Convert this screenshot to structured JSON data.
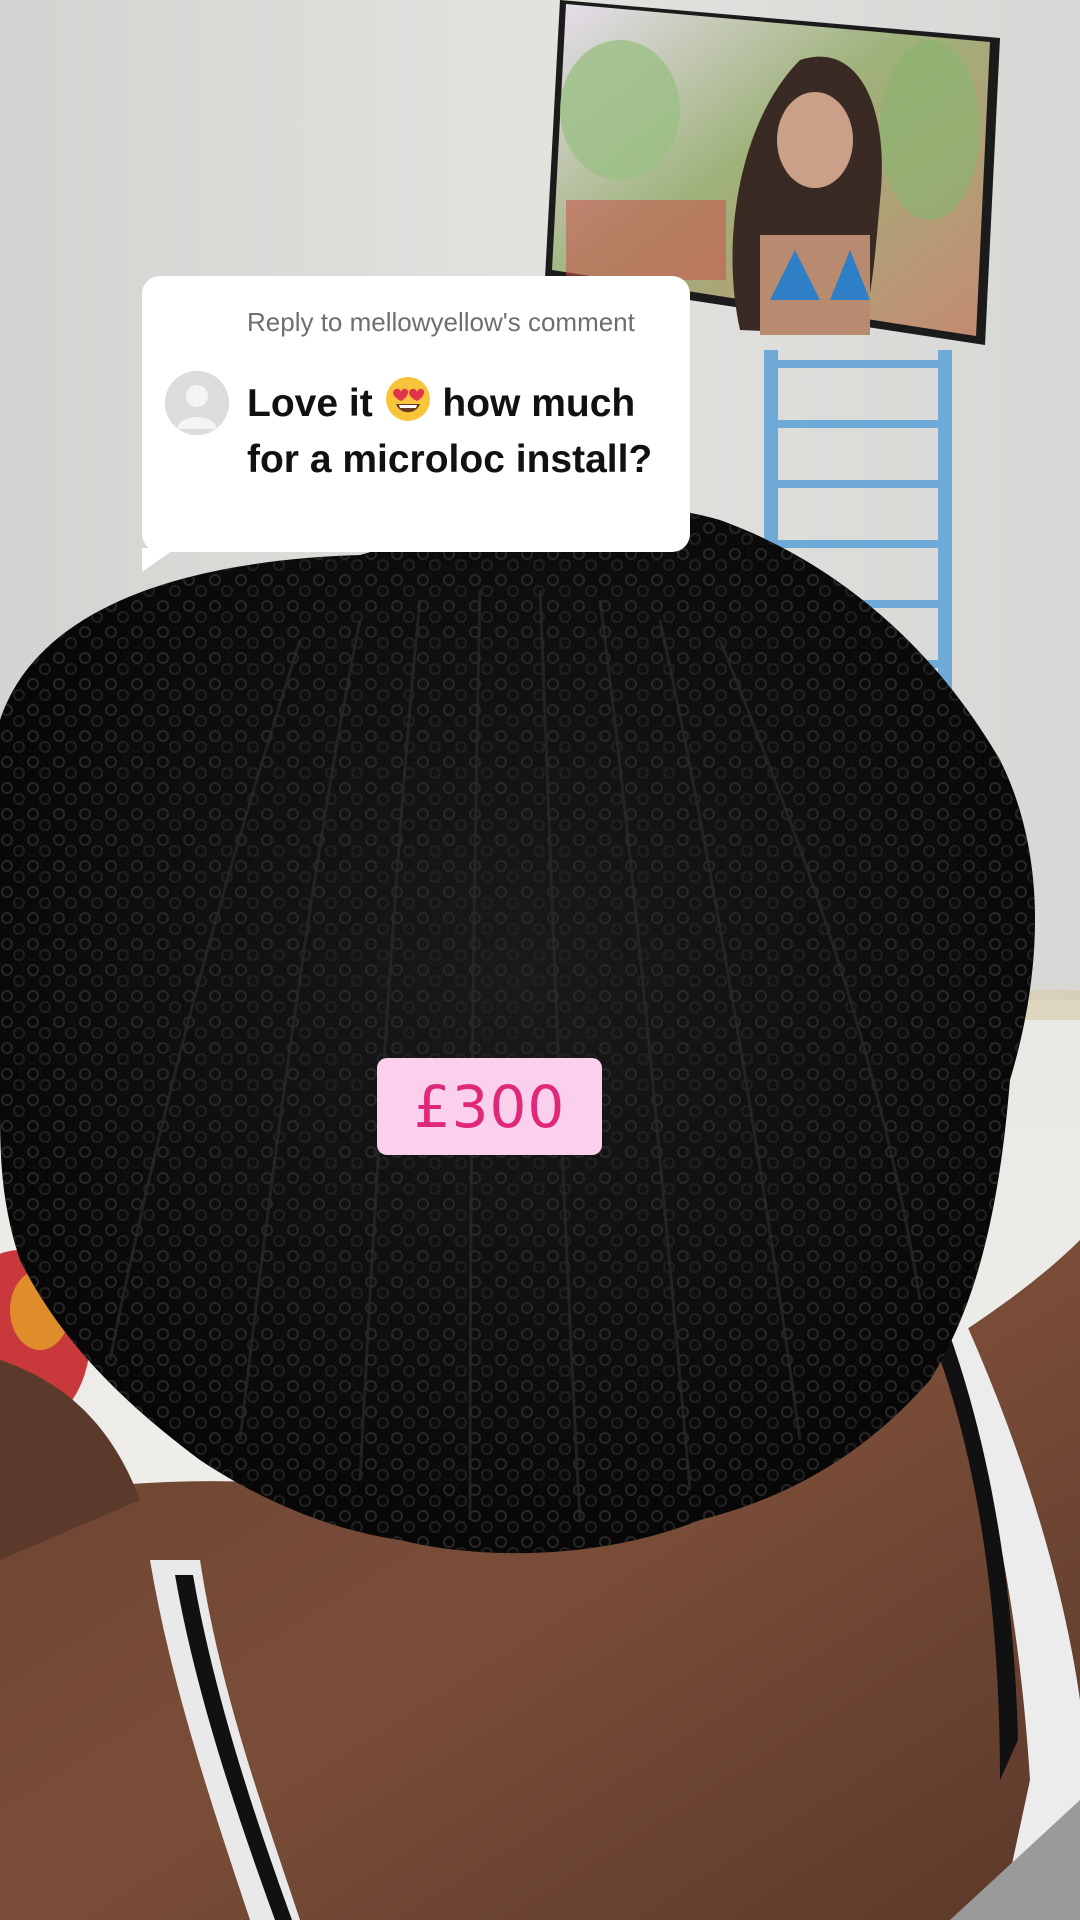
{
  "reply": {
    "header": "Reply to mellowyellow's comment",
    "text_before": "Love it",
    "emoji": "heart-eyes-emoji",
    "text_after": "how much for a microloc install?"
  },
  "price": "£300",
  "colors": {
    "price_bg": "#fbd0ec",
    "price_text": "#e0287a"
  }
}
